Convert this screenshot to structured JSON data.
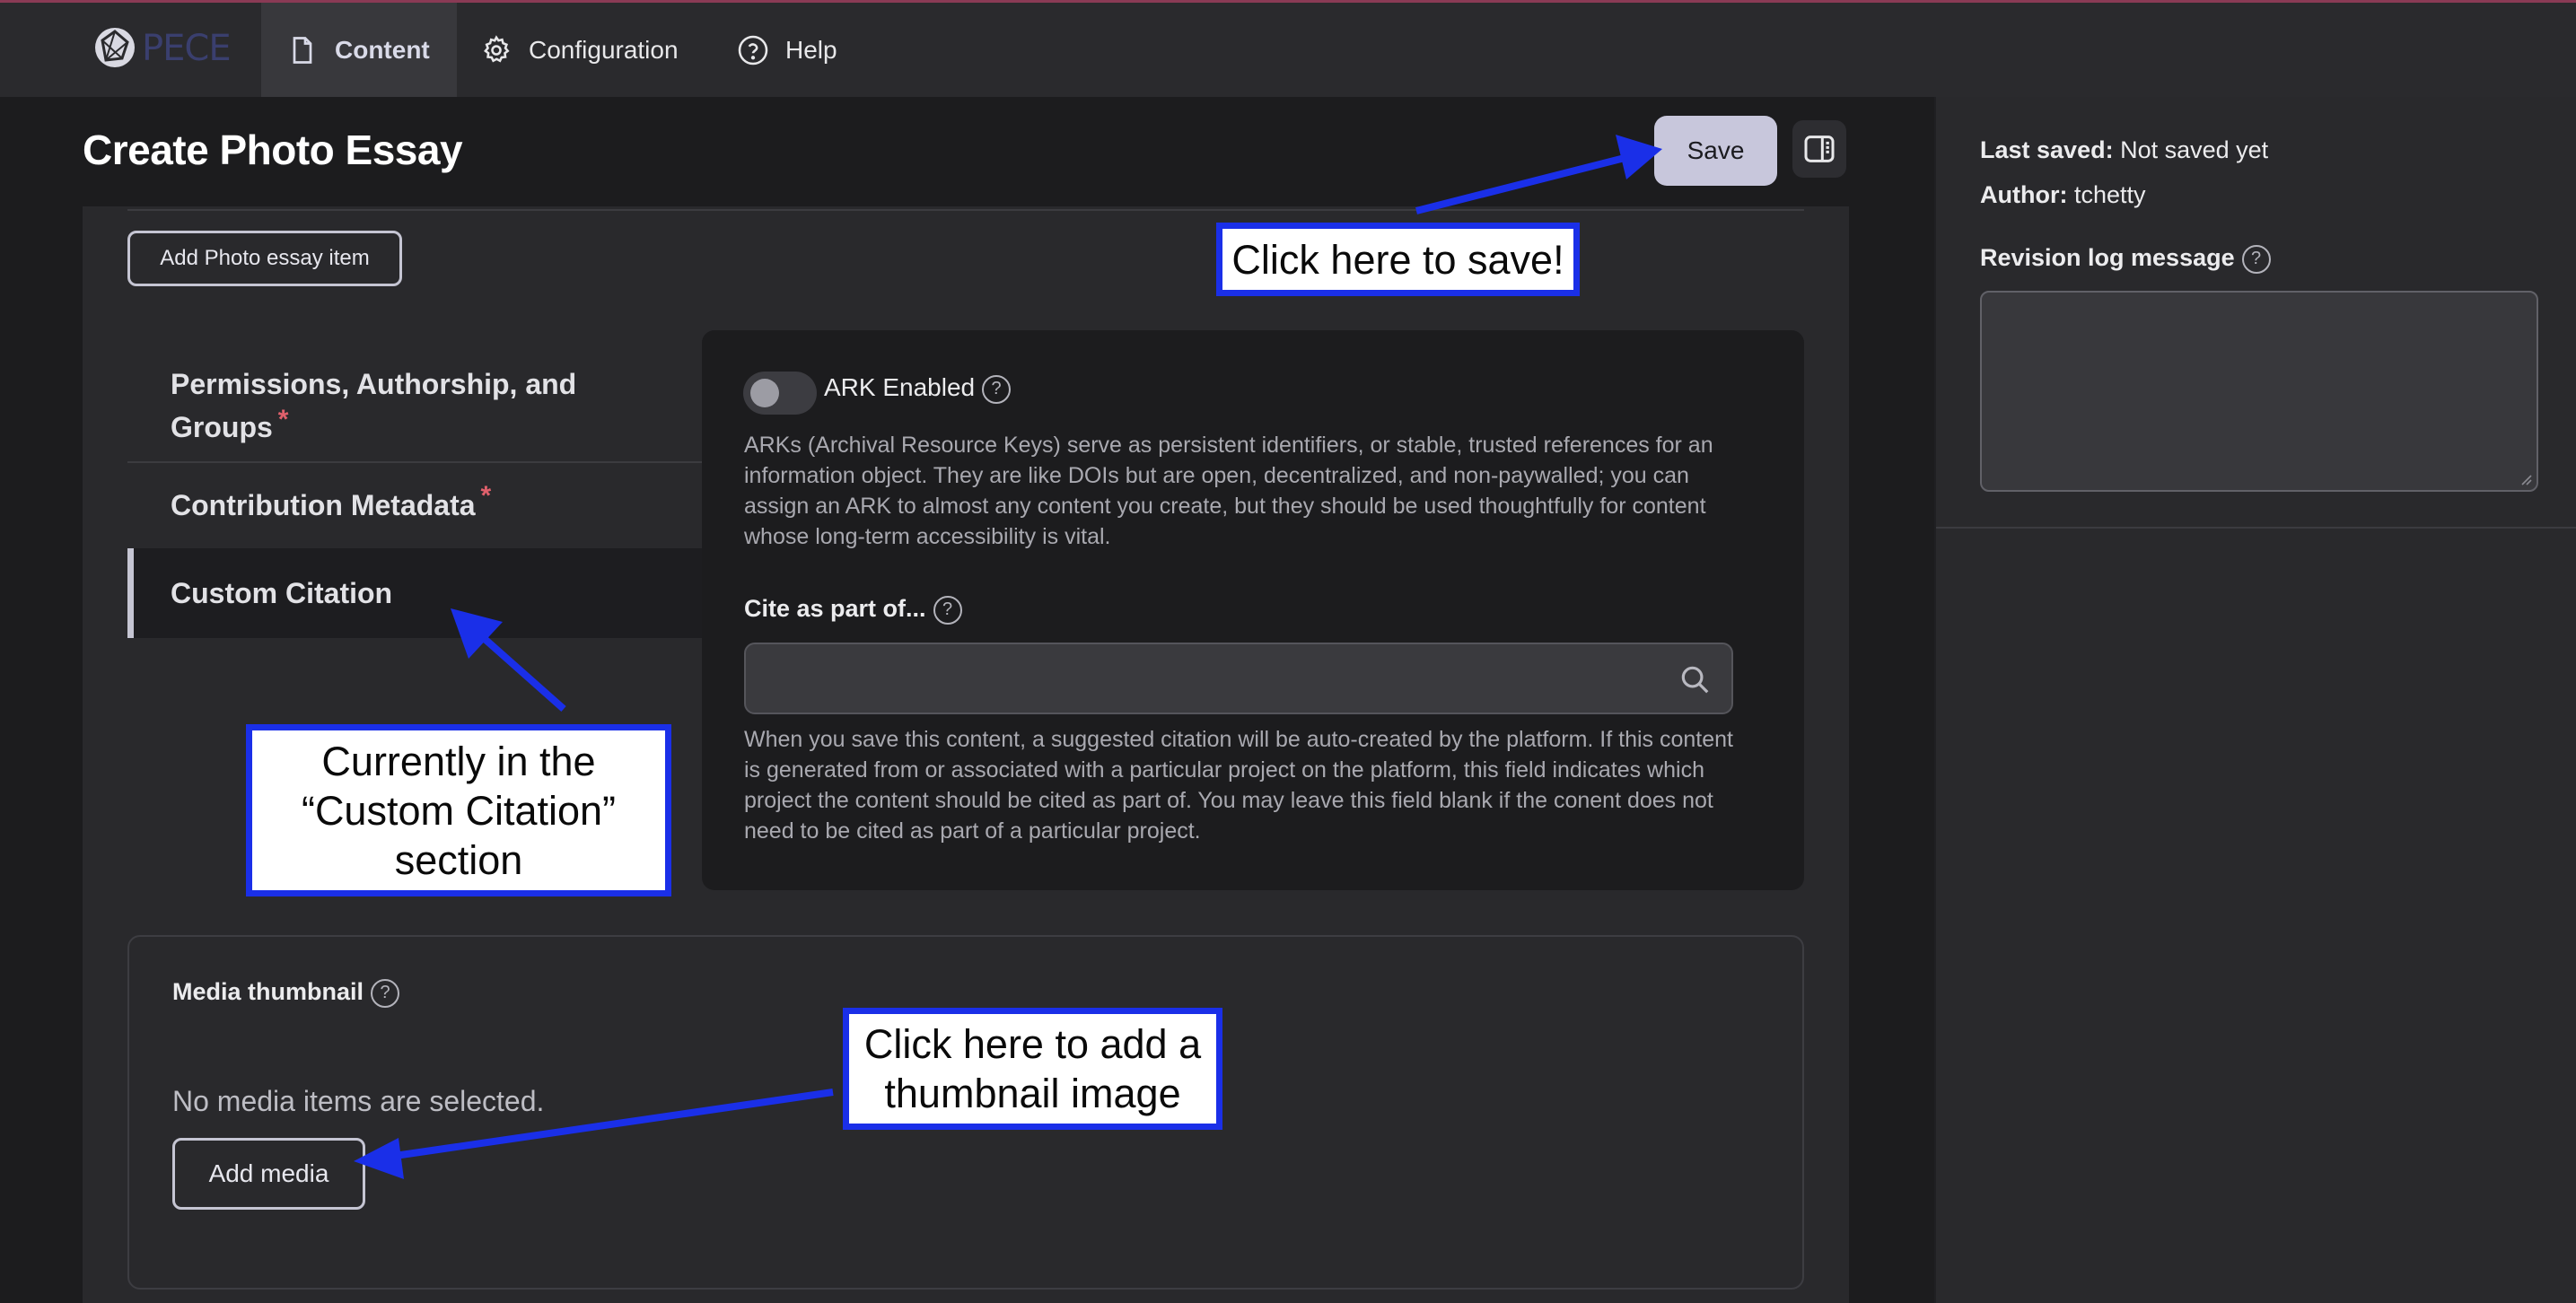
{
  "topbar": {
    "logo_text": "PECE",
    "tabs": [
      {
        "label": "Content",
        "icon": "document-icon"
      },
      {
        "label": "Configuration",
        "icon": "gear-icon"
      },
      {
        "label": "Help",
        "icon": "help-circle-icon"
      }
    ]
  },
  "page": {
    "title": "Create Photo Essay",
    "save_label": "Save"
  },
  "form": {
    "add_item_label": "Add Photo essay item",
    "vertical_tabs": [
      {
        "label": "Permissions, Authorship, and Groups",
        "required": "*"
      },
      {
        "label": "Contribution Metadata",
        "required": "*"
      },
      {
        "label": "Custom Citation",
        "active": true
      }
    ],
    "ark": {
      "label": "ARK Enabled",
      "enabled": false,
      "description": "ARKs (Archival Resource Keys) serve as persistent identifiers, or stable, trusted references for an information object. They are like DOIs but are open, decentralized, and non-paywalled; you can assign an ARK to almost any content you create, but they should be used thoughtfully for content whose long-term accessibility is vital."
    },
    "cite": {
      "label": "Cite as part of...",
      "value": "",
      "description": "When you save this content, a suggested citation will be auto-created by the platform. If this content is generated from or associated with a particular project on the platform, this field in­dicates which project the content should be cited as part of. You may leave this field blank if the conent does not need to be cited as part of a particular project."
    },
    "media": {
      "label": "Media thumbnail",
      "empty_text": "No media items are selected.",
      "add_label": "Add media"
    }
  },
  "sidebar": {
    "last_saved_label": "Last saved:",
    "last_saved_value": "Not saved yet",
    "author_label": "Author:",
    "author_value": "tchetty",
    "revision_label": "Revision log message",
    "revision_value": ""
  },
  "annotations": {
    "save_note": "Click here to save!",
    "section_note_1": "Currently in the",
    "section_note_2": "“Custom Citation”",
    "section_note_3": "section",
    "thumb_note_1": "Click here to add a",
    "thumb_note_2": "thumbnail image"
  },
  "colors": {
    "annotation_blue": "#1a2fe8",
    "save_button": "#c8c7dc",
    "required_star": "#e0606c"
  }
}
